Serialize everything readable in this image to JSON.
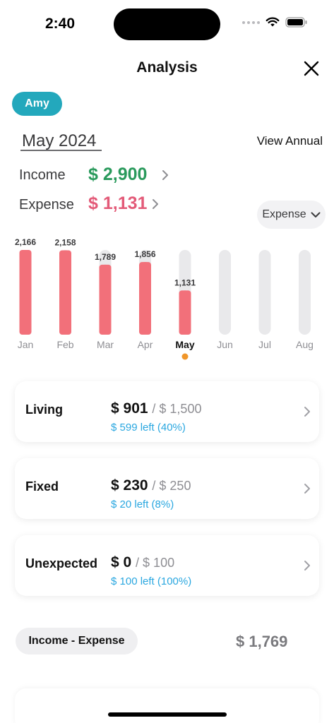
{
  "status_bar": {
    "time": "2:40"
  },
  "header": {
    "title": "Analysis"
  },
  "user": {
    "name": "Amy"
  },
  "period": {
    "month_label": "May 2024",
    "view_annual_label": "View Annual"
  },
  "summary": {
    "income_label": "Income",
    "income_value": "$ 2,900",
    "expense_label": "Expense",
    "expense_value": "$ 1,131"
  },
  "type_select": {
    "selected": "Expense"
  },
  "chart_data": {
    "type": "bar",
    "categories": [
      "Jan",
      "Feb",
      "Mar",
      "Apr",
      "May",
      "Jun",
      "Jul",
      "Aug"
    ],
    "values": [
      2166,
      2158,
      1789,
      1856,
      1131,
      null,
      null,
      null
    ],
    "value_labels": [
      "2,166",
      "2,158",
      "1,789",
      "1,856",
      "1,131",
      "",
      "",
      ""
    ],
    "selected_category": "May",
    "bar_color": "#f2707a",
    "track_color": "#e9e9eb",
    "selected_marker_color": "#f0962a",
    "ylim": [
      0,
      2166
    ]
  },
  "categories_list": [
    {
      "name": "Living",
      "amount": "$ 901",
      "budget": "/ $ 1,500",
      "left": "$ 599 left (40%)"
    },
    {
      "name": "Fixed",
      "amount": "$ 230",
      "budget": "/ $ 250",
      "left": "$ 20 left (8%)"
    },
    {
      "name": "Unexpected",
      "amount": "$ 0",
      "budget": "/ $ 100",
      "left": "$ 100 left (100%)"
    }
  ],
  "net": {
    "label": "Income - Expense",
    "value": "$ 1,769"
  },
  "colors": {
    "accent": "#23a8bc",
    "income": "#2a9a5c",
    "expense": "#e35a78",
    "remaining": "#2aa7e0"
  }
}
